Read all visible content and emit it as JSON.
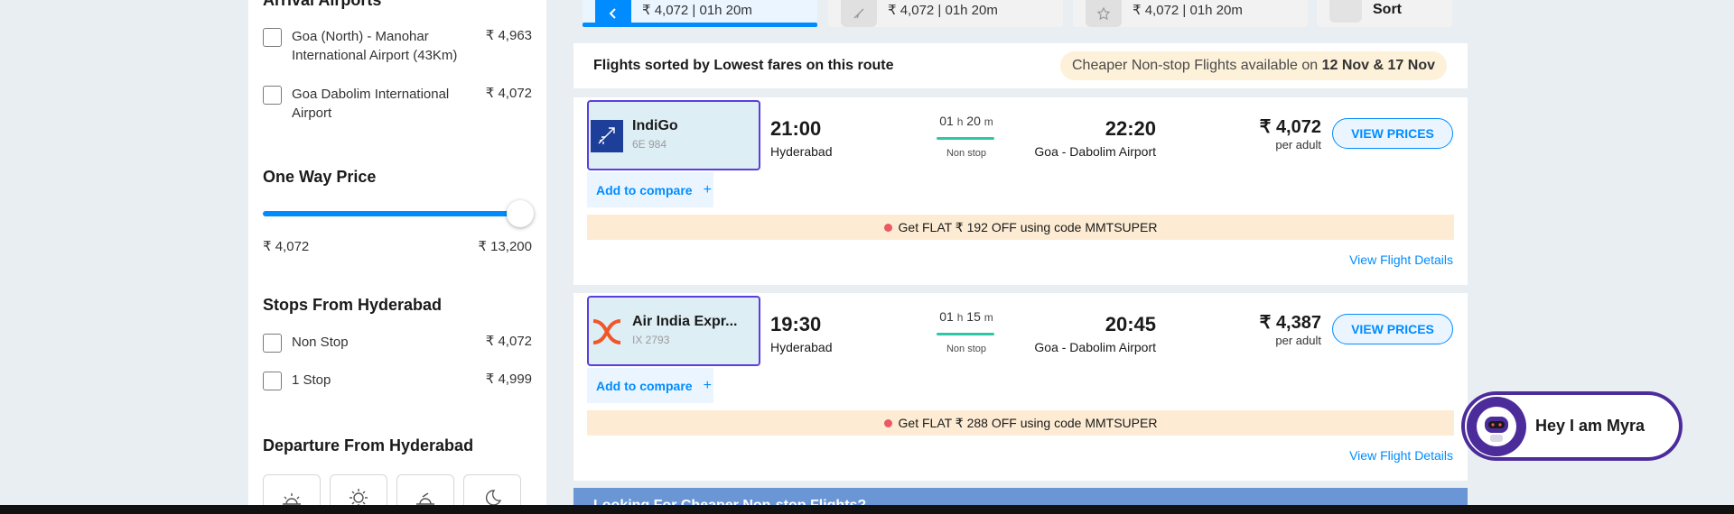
{
  "sidebar": {
    "arrival_title": "Arrival Airports",
    "arrival_airports": [
      {
        "label": "Goa (North) - Manohar International Airport (43Km)",
        "price": "₹ 4,963"
      },
      {
        "label": "Goa Dabolim International Airport",
        "price": "₹ 4,072"
      }
    ],
    "price_title": "One Way Price",
    "price_min": "₹ 4,072",
    "price_max": "₹ 13,200",
    "price_slider_fraction": 1.0,
    "stops_title": "Stops From Hyderabad",
    "stops": [
      {
        "label": "Non Stop",
        "price": "₹ 4,072"
      },
      {
        "label": "1 Stop",
        "price": "₹ 4,999"
      }
    ],
    "departure_title": "Departure From Hyderabad",
    "departure_slots": [
      "sunrise-icon",
      "sun-icon",
      "sunset-icon",
      "moon-icon"
    ]
  },
  "date_tabs": [
    {
      "text": "₹ 4,072 | 01h 20m",
      "active": true,
      "icon": "chevron-left-icon"
    },
    {
      "text": "₹ 4,072 | 01h 20m",
      "active": false,
      "icon": "plane-icon"
    },
    {
      "text": "₹ 4,072 | 01h 20m",
      "active": false,
      "icon": "star-icon"
    }
  ],
  "sort_label": "Sort",
  "header": {
    "title": "Flights sorted by Lowest fares on this route",
    "pill_text": "Cheaper Non-stop Flights available on ",
    "pill_dates": "12 Nov & 17 Nov"
  },
  "flights": [
    {
      "airline": "IndiGo",
      "code": "6E 984",
      "dep_time": "21:00",
      "dep_city": "Hyderabad",
      "dur_h": "01",
      "dur_m": "20",
      "stops": "Non stop",
      "arr_time": "22:20",
      "arr_city": "Goa - Dabolim Airport",
      "price": "₹ 4,072",
      "per": "per adult",
      "cta": "VIEW PRICES",
      "compare": "Add to compare",
      "offer": "Get FLAT ₹ 192 OFF using code MMTSUPER",
      "details": "View Flight Details"
    },
    {
      "airline": "Air India Expr...",
      "code": "IX 2793",
      "dep_time": "19:30",
      "dep_city": "Hyderabad",
      "dur_h": "01",
      "dur_m": "15",
      "stops": "Non stop",
      "arr_time": "20:45",
      "arr_city": "Goa - Dabolim Airport",
      "price": "₹ 4,387",
      "per": "per adult",
      "cta": "VIEW PRICES",
      "compare": "Add to compare",
      "offer": "Get FLAT ₹ 288 OFF using code MMTSUPER",
      "details": "View Flight Details"
    }
  ],
  "labels": {
    "h": "h",
    "m": "m",
    "plus": "+"
  },
  "banner": "Looking For Cheaper Non-stop Flights?",
  "myra": "Hey I am Myra",
  "colors": {
    "accent": "#008cff",
    "select_border": "#5b3ee0",
    "offer_bg": "#fdecd3",
    "myra": "#4c2b9a"
  }
}
